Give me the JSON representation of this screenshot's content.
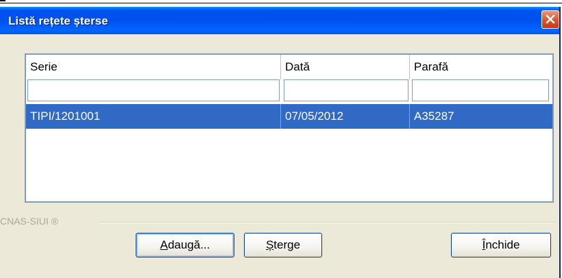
{
  "window": {
    "title": "Listă rețete șterse"
  },
  "columns": [
    "Serie",
    "Dată",
    "Parafă"
  ],
  "filters": [
    "",
    "",
    ""
  ],
  "rows": [
    [
      "TIPI/1201001",
      "07/05/2012",
      "A35287"
    ]
  ],
  "brand": "CNAS-SIUI ®",
  "buttons": {
    "add": {
      "first": "A",
      "rest": "daugă..."
    },
    "delete": {
      "first": "Ș",
      "rest": "terge"
    },
    "close": {
      "first": "Î",
      "rest": "nchide"
    }
  },
  "colors": {
    "selection": "#316AC5",
    "titlebar": "#0053EE",
    "dialog_bg": "#ECE9D8"
  },
  "icons": {
    "close": "close-icon"
  }
}
